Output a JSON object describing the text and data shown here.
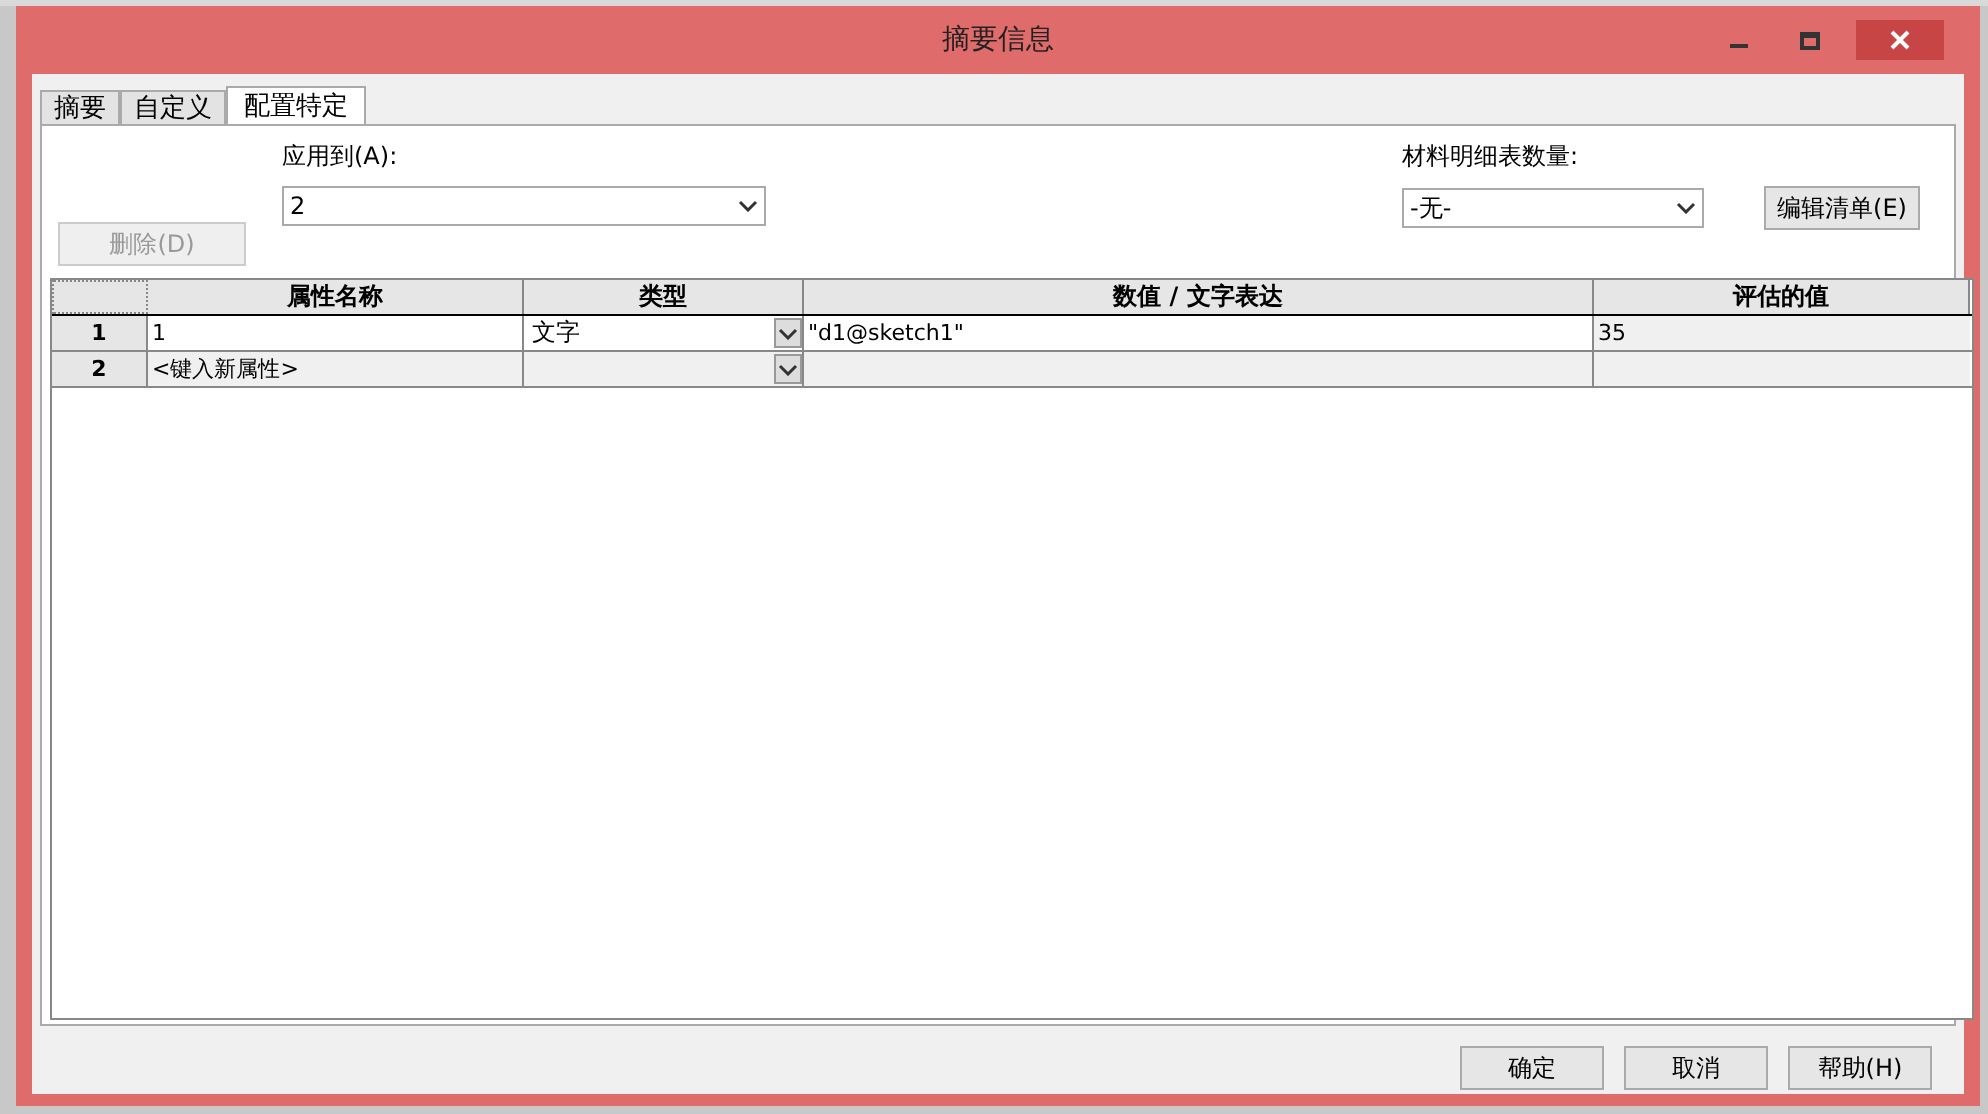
{
  "window": {
    "title": "摘要信息"
  },
  "tabs": [
    {
      "label": "摘要",
      "selected": false
    },
    {
      "label": "自定义",
      "selected": false
    },
    {
      "label": "配置特定",
      "selected": true
    }
  ],
  "delete_button": {
    "label": "删除(D)",
    "disabled": true
  },
  "apply_to": {
    "label": "应用到(A):",
    "value": "2"
  },
  "bom_quantity": {
    "label": "材料明细表数量:",
    "value": "-无-"
  },
  "edit_list_button": {
    "label": "编辑清单(E)"
  },
  "table": {
    "columns": [
      "属性名称",
      "类型",
      "数值 / 文字表达",
      "评估的值"
    ],
    "rows": [
      {
        "number": "1",
        "name": "1",
        "type": "文字",
        "value": "\"d1@sketch1\"",
        "evaluated": "35"
      },
      {
        "number": "2",
        "name": "<键入新属性>",
        "type": "",
        "value": "",
        "evaluated": ""
      }
    ]
  },
  "buttons": [
    "确定",
    "取消",
    "帮助(H)"
  ]
}
